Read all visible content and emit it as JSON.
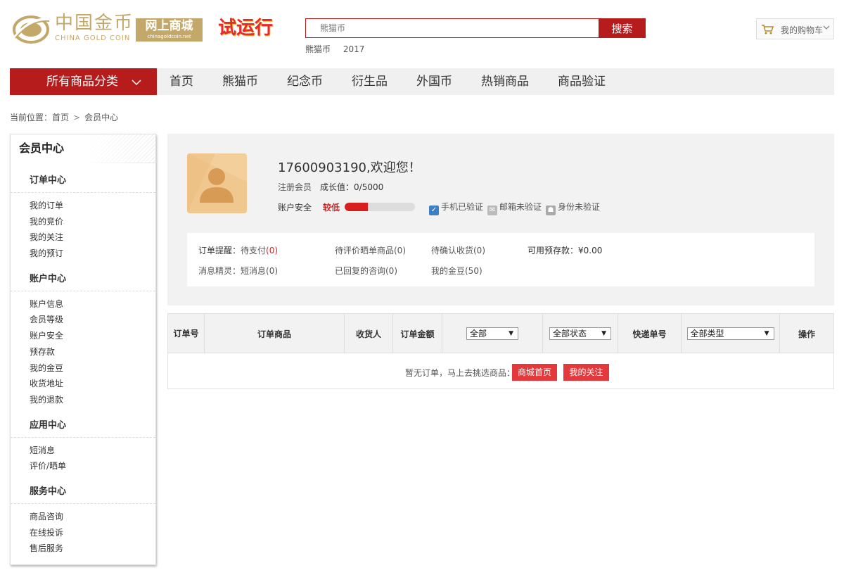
{
  "header": {
    "logo_cn": "中国金币",
    "logo_en": "CHINA GOLD COIN",
    "mall_cn": "网上商城",
    "mall_en": "chinagoldcoin.net",
    "trial": "试运行",
    "search": {
      "placeholder": "熊猫币",
      "button": "搜索"
    },
    "hot_words": [
      "熊猫币",
      "2017"
    ],
    "cart_label": "我的购物车"
  },
  "nav": {
    "all_label": "所有商品分类",
    "items": [
      "首页",
      "熊猫币",
      "纪念币",
      "衍生品",
      "外国币",
      "热销商品",
      "商品验证"
    ]
  },
  "breadcrumb": {
    "prefix": "当前位置：",
    "home": "首页",
    "sep": ">",
    "current": "会员中心"
  },
  "sidebar": {
    "title": "会员中心",
    "groups": [
      {
        "title": "订单中心",
        "items": [
          "我的订单",
          "我的竞价",
          "我的关注",
          "我的预订"
        ]
      },
      {
        "title": "账户中心",
        "items": [
          "账户信息",
          "会员等级",
          "账户安全",
          "预存款",
          "我的金豆",
          "收货地址",
          "我的退款"
        ]
      },
      {
        "title": "应用中心",
        "items": [
          "短消息",
          "评价/晒单"
        ]
      },
      {
        "title": "服务中心",
        "items": [
          "商品咨询",
          "在线投诉",
          "售后服务"
        ]
      }
    ]
  },
  "profile": {
    "welcome": "17600903190,欢迎您！",
    "member_type": "注册会员",
    "growth": "成长值：0/5000",
    "security_label": "账户安全",
    "security_level": "较低",
    "security_progress": 0.33,
    "verify": [
      {
        "label": "手机已验证",
        "icon": "phone-verified-icon"
      },
      {
        "label": "邮箱未验证",
        "icon": "mail-unverified-icon"
      },
      {
        "label": "身份未验证",
        "icon": "id-unverified-icon"
      }
    ]
  },
  "reminders": {
    "order_label": "订单提醒：",
    "pending_pay": "待支付",
    "pending_pay_count": "(0)",
    "to_review": "待评价晒单商品(0)",
    "to_confirm": "待确认收货(0)",
    "deposit": "可用预存款：¥0.00",
    "msg_label": "消息精灵：",
    "short_msg": "短消息(0)",
    "replied": "已回复的咨询(0)",
    "beans": "我的金豆(50)"
  },
  "orders": {
    "headers": {
      "order_no": "订单号",
      "product": "订单商品",
      "receiver": "收货人",
      "amount": "订单金额",
      "time_select": "全部",
      "status_select": "全部状态",
      "tracking": "快递单号",
      "type_select": "全部类型",
      "action": "操作"
    },
    "empty_text": "暂无订单，马上去挑选商品：",
    "btn_home": "商城首页",
    "btn_follow": "我的关注"
  },
  "colors": {
    "brand_red": "#b71c1c",
    "gold": "#c4a86a",
    "button_red": "#e4393c"
  }
}
